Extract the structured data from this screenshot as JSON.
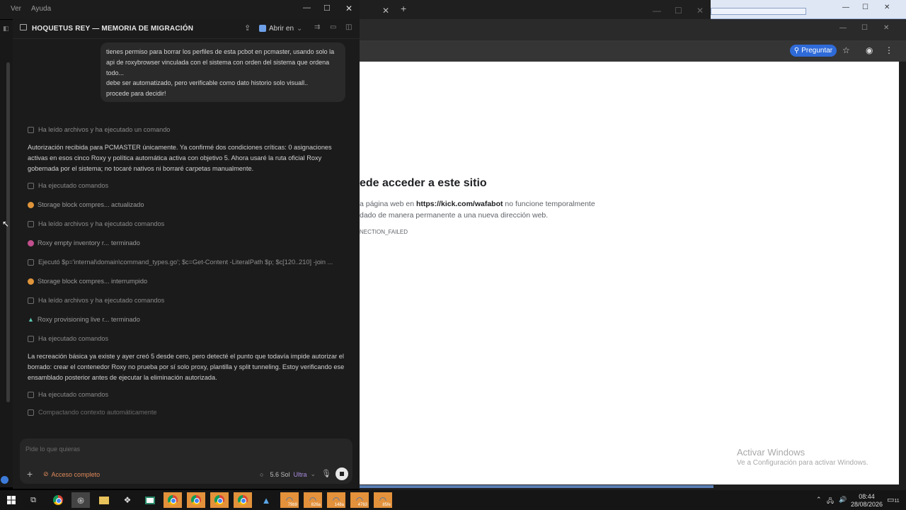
{
  "menu": {
    "items": [
      "Ver",
      "Ayuda"
    ]
  },
  "app": {
    "title": "HOQUETUS REY — MEMORIA DE MIGRACIÓN",
    "open_in": "Abrir en",
    "user_message": [
      "tienes permiso para borrar los perfiles de esta pcbot en pcmaster, usando solo la",
      "api de roxybrowser vinculada con el sistema con orden del sistema que ordena",
      "todo...",
      "debe ser automatizado, pero verificable como dato historio solo visuall..",
      "procede para decidir!"
    ],
    "timeline": {
      "a1": "Ha leído archivos y ha ejecutado un comando",
      "p1": "Autorización recibida para PCMASTER únicamente. Ya confirmé dos condiciones críticas: 0 asignaciones activas en esos cinco Roxy y política automática activa con objetivo 5. Ahora usaré la ruta oficial Roxy gobernada por el sistema; no tocaré nativos ni borraré carpetas manualmente.",
      "a2": "Ha ejecutado comandos",
      "t1": {
        "name": "Storage block compres...",
        "status": "actualizado"
      },
      "a3": "Ha leído archivos y ha ejecutado comandos",
      "t2": {
        "name": "Roxy empty inventory r...",
        "status": "terminado"
      },
      "cmd": "Ejecutó $p='internal\\domain\\command_types.go'; $c=Get-Content -LiteralPath $p; $c[120..210] -join ...",
      "t3": {
        "name": "Storage block compres...",
        "status": "interrumpido"
      },
      "a4": "Ha leído archivos y ha ejecutado comandos",
      "t4": {
        "name": "Roxy provisioning live r...",
        "status": "terminado"
      },
      "a5": "Ha ejecutado comandos",
      "p2": "La recreación básica ya existe y ayer creó 5 desde cero, pero detecté el punto que todavía impide autorizar el borrado: crear el contenedor Roxy no prueba por sí solo proxy, plantilla y split tunneling. Estoy verificando ese ensamblado posterior antes de ejecutar la eliminación autorizada.",
      "a6": "Ha ejecutado comandos",
      "a7": "Compactando contexto automáticamente"
    },
    "composer": {
      "placeholder": "Pide lo que quieras",
      "access": "Acceso completo",
      "model": "5.6 Sol",
      "mode": "Ultra"
    }
  },
  "browser": {
    "ask_button": "Preguntar",
    "error_title": "ede acceder a este sitio",
    "error_line1_pre": "a página web en ",
    "error_url": "https://kick.com/wafabot",
    "error_line1_post": " no funcione temporalmente",
    "error_line2": "dado de manera permanente a una nueva dirección web.",
    "error_code": "NECTION_FAILED"
  },
  "watermark": {
    "line1": "Activar Windows",
    "line2": "Ve a Configuración para activar Windows."
  },
  "taskbar": {
    "tiles": [
      "79b9",
      "826a",
      "148a",
      "4763",
      "85fe"
    ],
    "time": "08:44",
    "date": "28/08/2026",
    "notifications": "11"
  },
  "colors": {
    "accent_blue": "#2f6bd8",
    "access_orange": "#e08a5a",
    "ultra_purple": "#a98be0"
  }
}
